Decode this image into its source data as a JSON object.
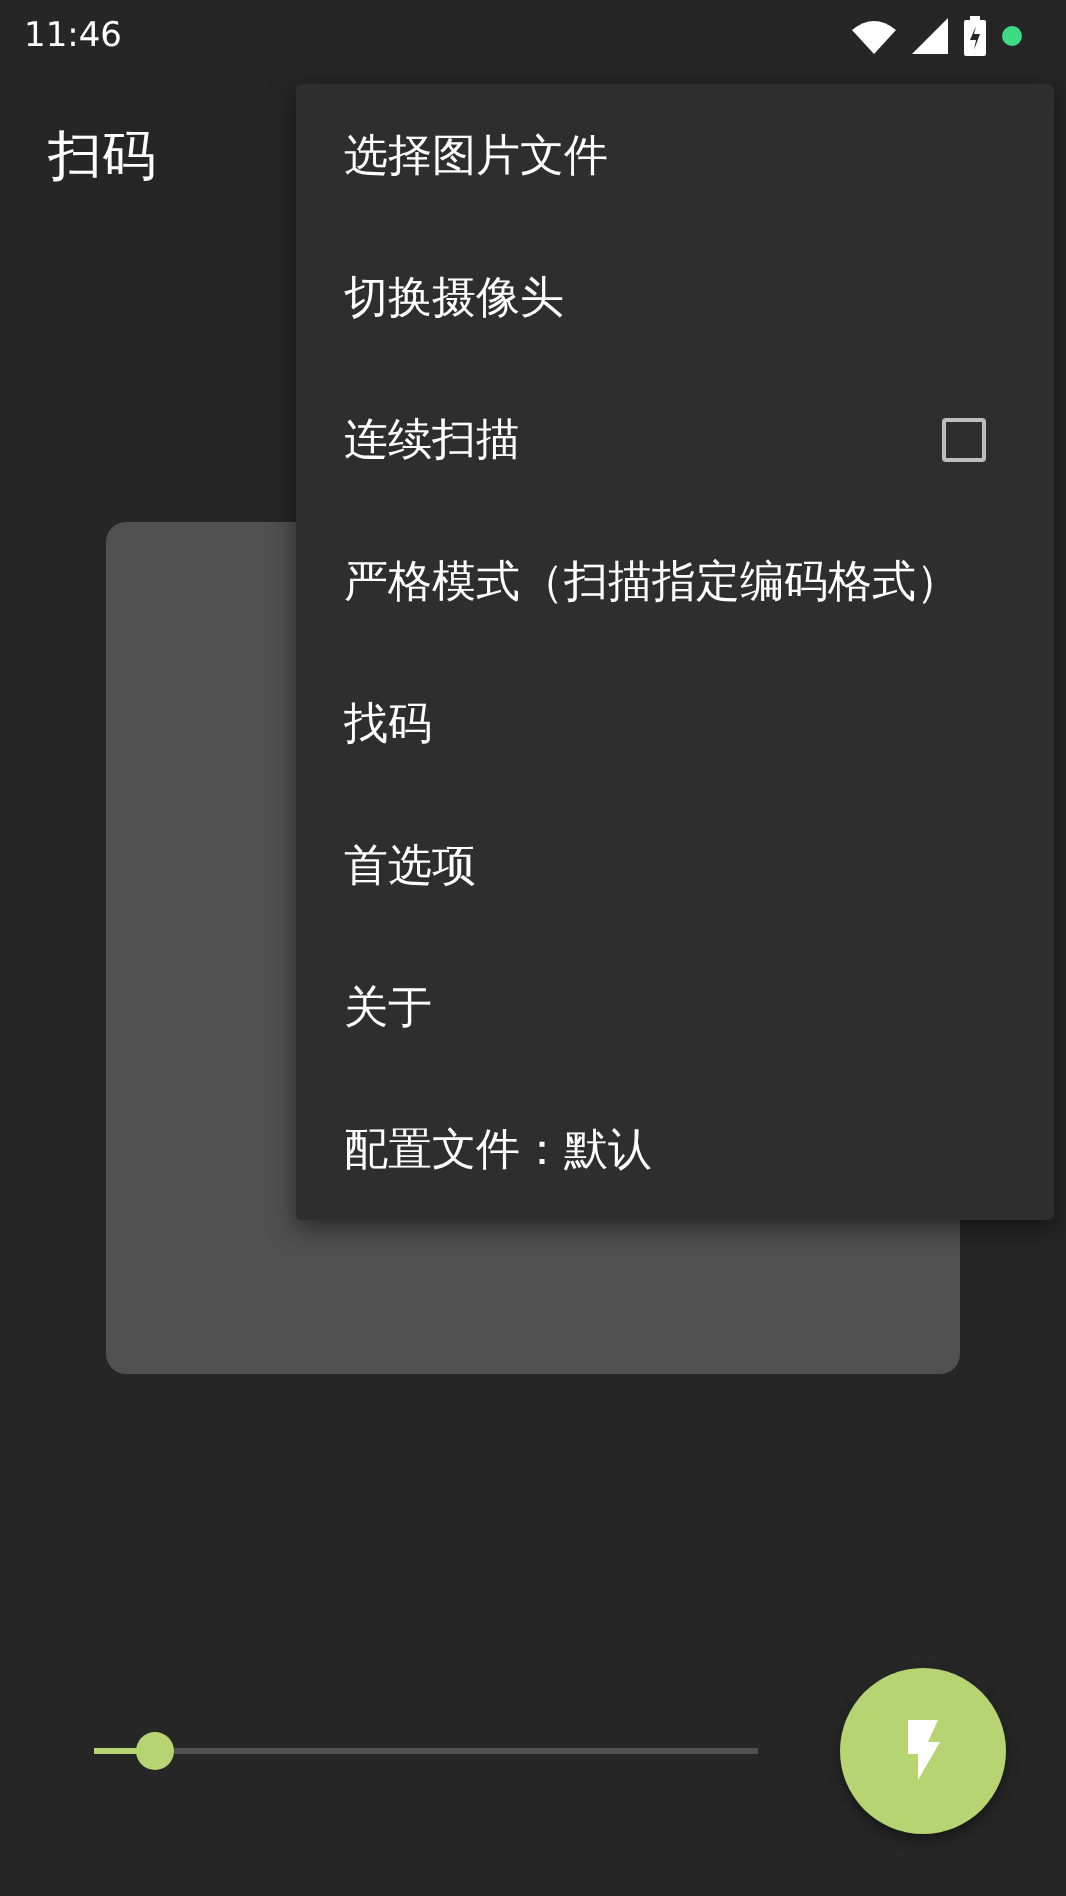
{
  "status_bar": {
    "time": "11:46"
  },
  "app_bar": {
    "title": "扫码"
  },
  "menu": {
    "items": [
      {
        "label": "选择图片文件",
        "kind": "plain"
      },
      {
        "label": "切换摄像头",
        "kind": "plain"
      },
      {
        "label": "连续扫描",
        "kind": "checkbox",
        "checked": false
      },
      {
        "label": "严格模式（扫描指定编码格式）",
        "kind": "plain"
      },
      {
        "label": "找码",
        "kind": "plain"
      },
      {
        "label": "首选项",
        "kind": "plain"
      },
      {
        "label": "关于",
        "kind": "plain"
      },
      {
        "label": "配置文件：默认",
        "kind": "plain"
      }
    ]
  },
  "zoom_slider": {
    "level": 0.09
  }
}
